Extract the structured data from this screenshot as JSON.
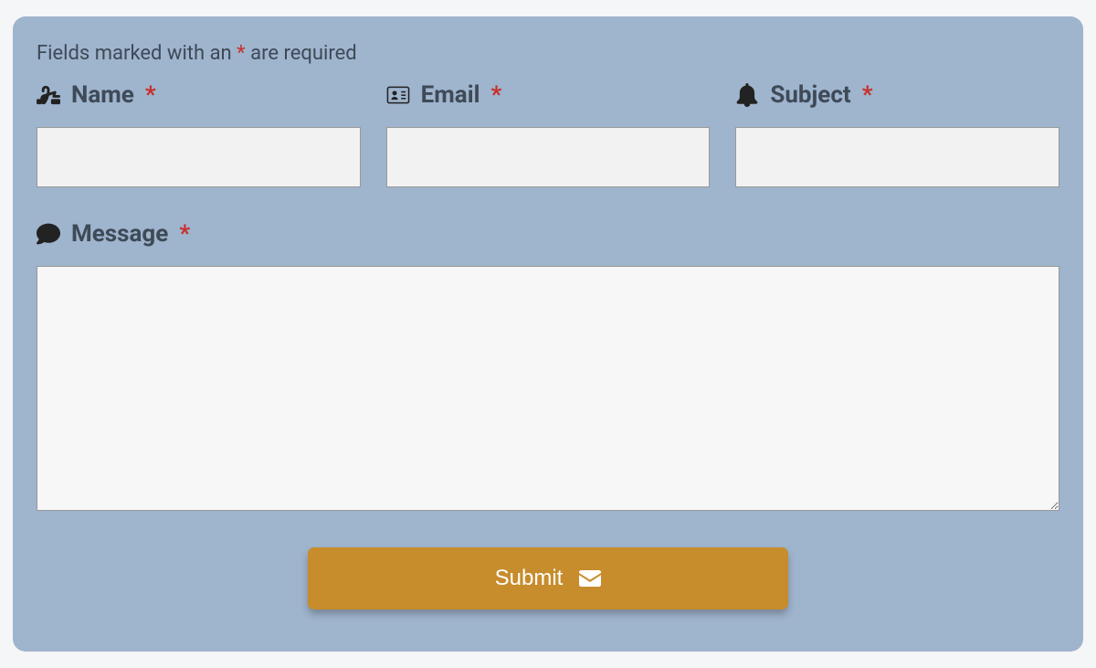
{
  "form": {
    "note_prefix": "Fields marked with an ",
    "note_asterisk": "*",
    "note_suffix": " are required",
    "fields": {
      "name": {
        "label": "Name",
        "required_marker": "*",
        "value": ""
      },
      "email": {
        "label": "Email",
        "required_marker": "*",
        "value": ""
      },
      "subject": {
        "label": "Subject",
        "required_marker": "*",
        "value": ""
      },
      "message": {
        "label": "Message",
        "required_marker": "*",
        "value": ""
      }
    },
    "submit_label": "Submit"
  },
  "colors": {
    "panel_bg": "#9fb4cd",
    "label_text": "#3e4a57",
    "required": "#c9302c",
    "button_bg": "#c78c2b"
  }
}
